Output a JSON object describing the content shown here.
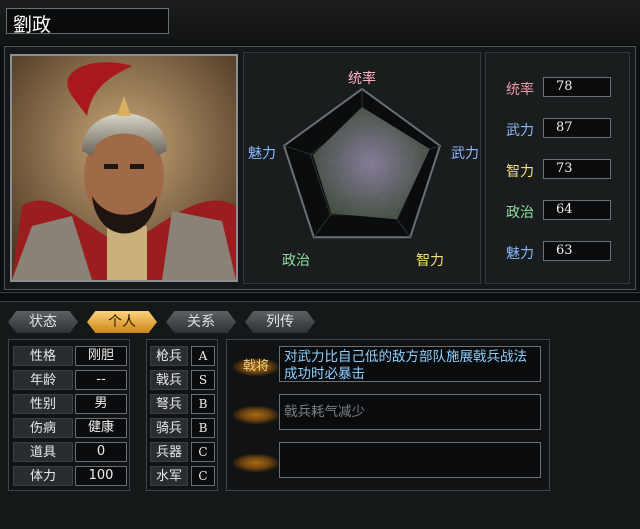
{
  "officer": {
    "name": "劉政"
  },
  "radar": {
    "labels": {
      "command": "统率",
      "war": "武力",
      "intelligence": "智力",
      "politics": "政治",
      "charm": "魅力"
    }
  },
  "stats": [
    {
      "label": "统率",
      "value": "78",
      "color": "#e79aa6"
    },
    {
      "label": "武力",
      "value": "87",
      "color": "#8ab8ff"
    },
    {
      "label": "智力",
      "value": "73",
      "color": "#f2e07a"
    },
    {
      "label": "政治",
      "value": "64",
      "color": "#8fe0a0"
    },
    {
      "label": "魅力",
      "value": "63",
      "color": "#8ab8ff"
    }
  ],
  "tabs": [
    {
      "label": "状态",
      "active": false
    },
    {
      "label": "个人",
      "active": true
    },
    {
      "label": "关系",
      "active": false
    },
    {
      "label": "列传",
      "active": false
    }
  ],
  "personal": [
    {
      "label": "性格",
      "value": "刚胆"
    },
    {
      "label": "年龄",
      "value": "--"
    },
    {
      "label": "性别",
      "value": "男"
    },
    {
      "label": "伤病",
      "value": "健康"
    },
    {
      "label": "道具",
      "value": "0"
    },
    {
      "label": "体力",
      "value": "100"
    }
  ],
  "troops": [
    {
      "label": "枪兵",
      "value": "A"
    },
    {
      "label": "戟兵",
      "value": "S"
    },
    {
      "label": "弩兵",
      "value": "B"
    },
    {
      "label": "骑兵",
      "value": "B"
    },
    {
      "label": "兵器",
      "value": "C"
    },
    {
      "label": "水军",
      "value": "C"
    }
  ],
  "skills": [
    {
      "tag": "戟将",
      "description": "对武力比自己低的敌方部队施展戟兵战法成功时必暴击",
      "active": true
    },
    {
      "tag": "",
      "description": "戟兵耗气减少",
      "active": false
    },
    {
      "tag": "",
      "description": "",
      "active": false
    }
  ],
  "colors": {
    "accent": "#f0c060",
    "radar_label": "#ffb0c0"
  }
}
